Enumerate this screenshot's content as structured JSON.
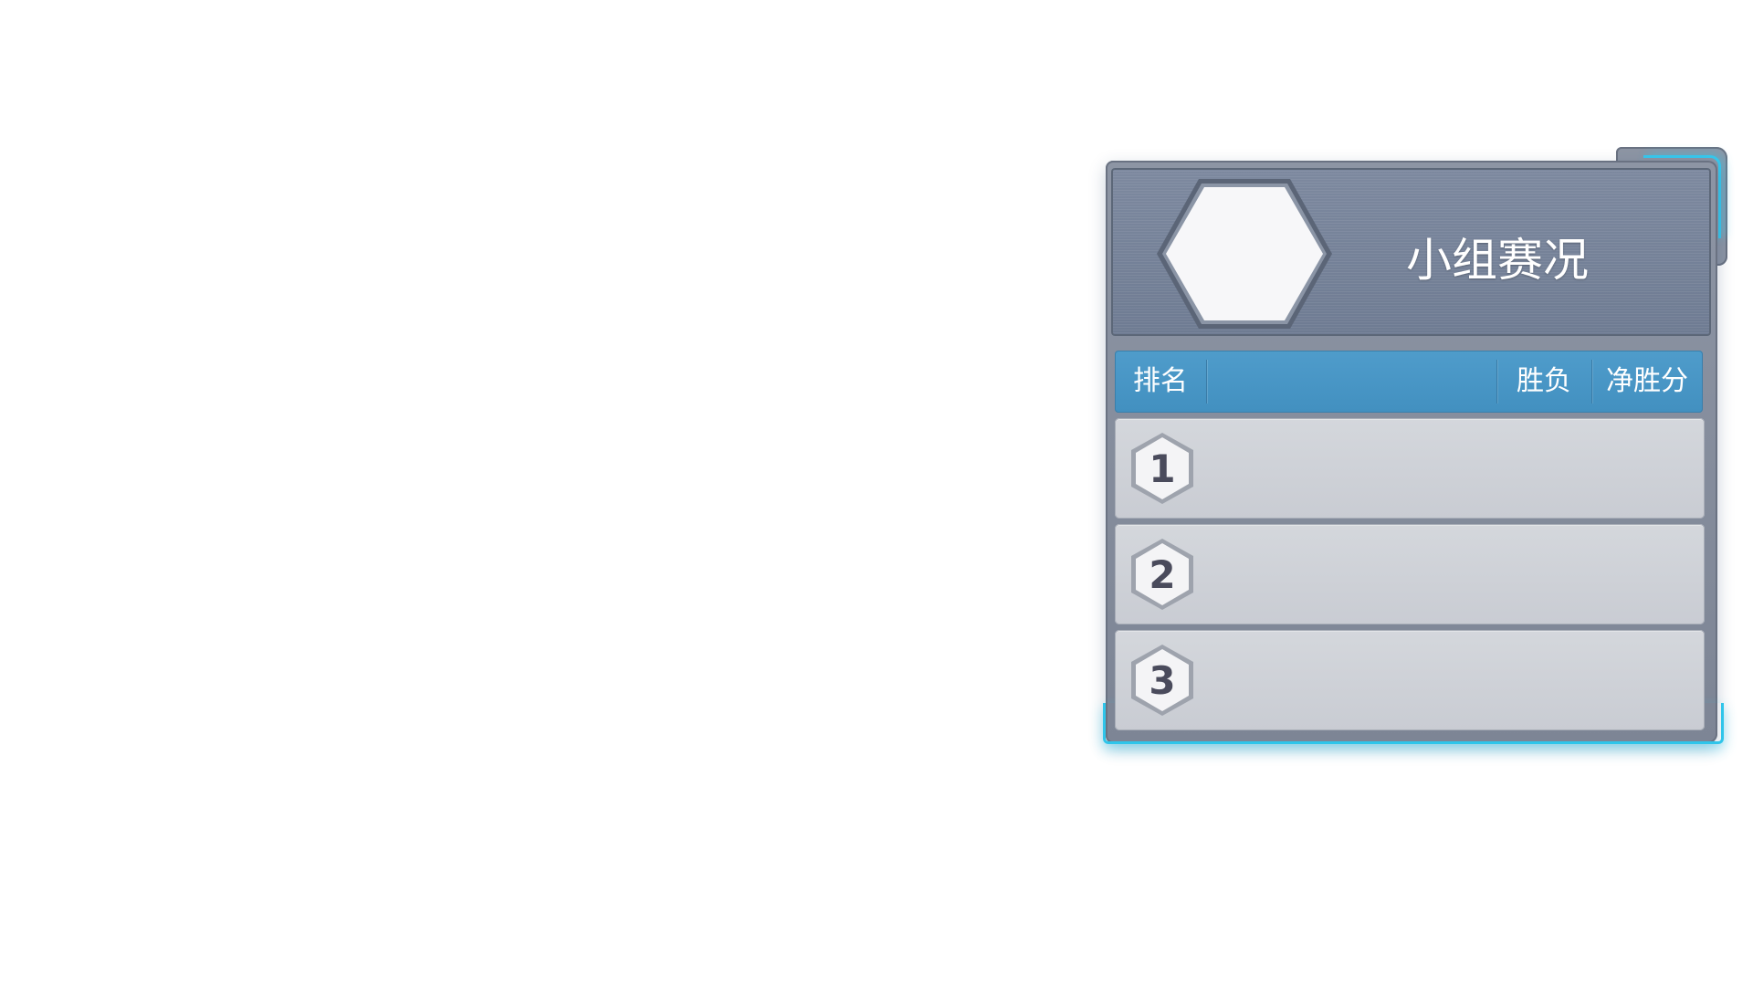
{
  "panel": {
    "title": "小组赛况",
    "columns": {
      "rank": "排名",
      "win_loss": "胜负",
      "net_score": "净胜分"
    },
    "rows": [
      {
        "rank": "1"
      },
      {
        "rank": "2"
      },
      {
        "rank": "3"
      }
    ]
  },
  "colors": {
    "panel_bg": "#8d95a4",
    "header_bg": "#75839a",
    "column_bar": "#4896c6",
    "row_bg": "#cdd0d6",
    "glow": "#37c9ee",
    "rank_text": "#4a4b5c"
  },
  "icons": {
    "group_emblem": "hexagon-emblem-icon",
    "rank_badge": "hexagon-rank-badge-icon"
  }
}
